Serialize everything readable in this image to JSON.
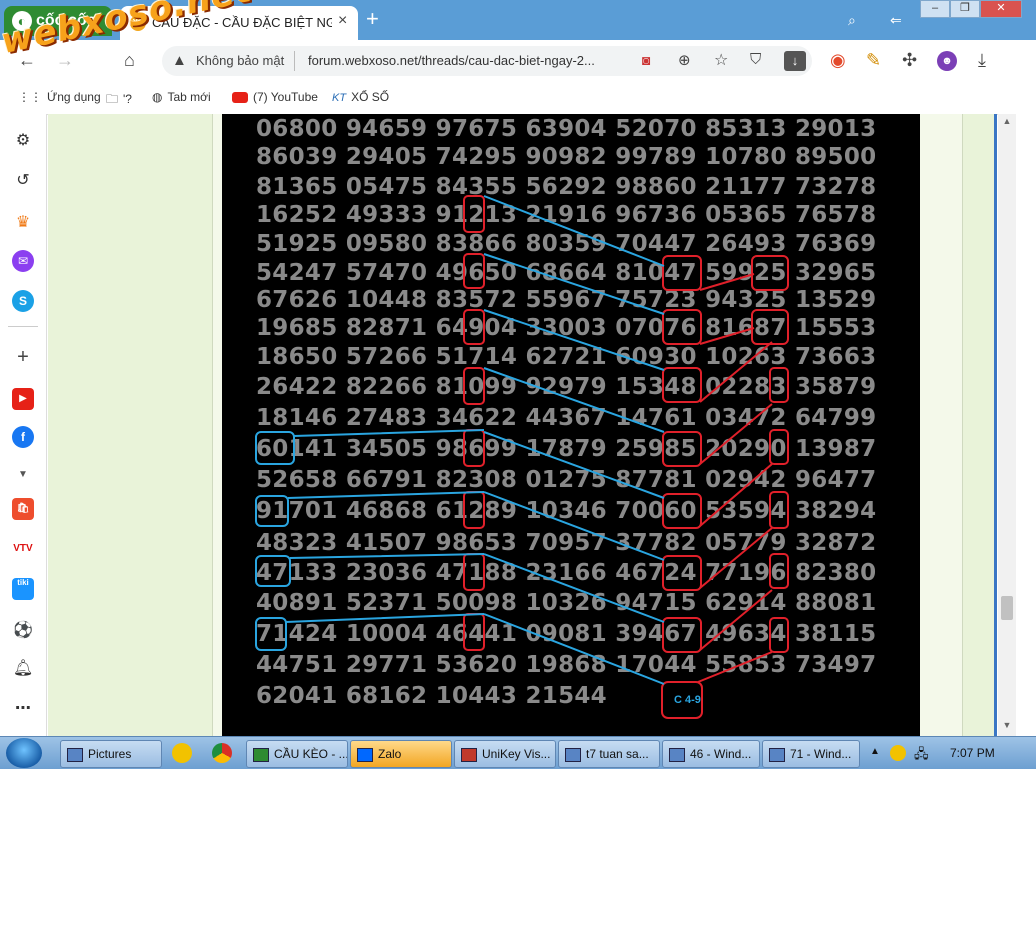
{
  "browser": {
    "brand": "cốc cốc",
    "tab": {
      "favicon": "XS",
      "title": "CẦU ĐẶC - CẦU ĐẶC BIỆT NGÀY"
    },
    "omnibox": {
      "security": "Không bảo mật",
      "url": "forum.webxoso.net/threads/cau-dac-biet-ngay-2..."
    },
    "bookmarks": [
      {
        "label": "Ứng dụng",
        "icon": "apps-grid-icon"
      },
      {
        "label": "'?",
        "icon": "folder-icon"
      },
      {
        "label": "Tab mới",
        "icon": "globe-icon"
      },
      {
        "label": "(7) YouTube",
        "icon": "youtube-icon"
      },
      {
        "label": "XỔ SỐ",
        "icon": "kt-logo-icon"
      }
    ],
    "watermark": "webxoso.net"
  },
  "board": {
    "rows": [
      "06800 94659 97675 63904 52070 85313 29013",
      "86039 29405 74295 90982 99789 10780 89500",
      "81365 05475 84355 56292 98860 21177 73278",
      "16252 49333 91213 21916 96736 05365 76578",
      "51925 09580 83866 80359 70447 26493 76369",
      "54247 57470 49650 68664 81047 59925 32965",
      "67626 10448 83572 55967 75723 94325 13529",
      "19685 82871 64904 33003 07076 81687 15553",
      "18650 57266 51714 62721 60930 10263 73663",
      "26422 82266 81099 92979 15348 02283 35879",
      "18146 27483 34622 44367 14761 03472 64799",
      "60141 34505 98699 17879 25985 20290 13987",
      "52658 66791 82308 01275 87781 02942 96477",
      "91701 46868 61289 10346 70060 53594 38294",
      "48323 41507 98653 70957 37782 05779 32872",
      "47133 23036 47188 23166 46724 77196 82380",
      "40891 52371 50098 10326 94715 62914 88081",
      "71424 10004 46441 09081 39467 49634 38115",
      "44751 29771 53620 19868 17044 55853 73497",
      "62041 68162 10443 21544"
    ],
    "annotation_label": "C 4-9"
  },
  "taskbar": {
    "buttons": [
      {
        "label": "Pictures"
      },
      {
        "label": "CẦU KÈO - ..."
      },
      {
        "label": "Zalo"
      },
      {
        "label": "UniKey Vis..."
      },
      {
        "label": "t7 tuan sa..."
      },
      {
        "label": "46 - Wind..."
      },
      {
        "label": "71 - Wind..."
      }
    ],
    "clock": "7:07 PM"
  },
  "colors": {
    "tabstrip": "#5a9dd6",
    "brand": "#2e8b32",
    "board_bg": "#000000",
    "digits": "#8a8a8a",
    "mark_red": "#e0202a",
    "mark_blue": "#2aa5e0"
  }
}
